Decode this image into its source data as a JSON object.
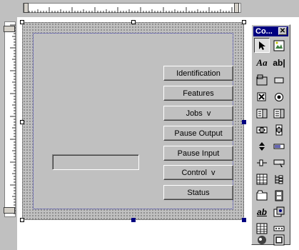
{
  "form": {
    "buttons": [
      {
        "label": "Identification"
      },
      {
        "label": "Features"
      },
      {
        "label": "Jobs  v"
      },
      {
        "label": "Pause Output"
      },
      {
        "label": "Pause Input"
      },
      {
        "label": "Control  v"
      },
      {
        "label": "Status"
      }
    ],
    "textbox_value": ""
  },
  "toolbox": {
    "title": "Co...",
    "close_glyph": "✕",
    "tools": [
      {
        "icon": "pointer-icon"
      },
      {
        "icon": "image-icon"
      },
      {
        "icon": "label-icon",
        "text": "Aa"
      },
      {
        "icon": "textbox-icon",
        "text": "ab|"
      },
      {
        "icon": "frame-icon"
      },
      {
        "icon": "command-button-icon"
      },
      {
        "icon": "checkbox-icon"
      },
      {
        "icon": "option-button-icon"
      },
      {
        "icon": "combobox-icon"
      },
      {
        "icon": "listbox-icon"
      },
      {
        "icon": "hscrollbar-icon"
      },
      {
        "icon": "vscrollbar-icon"
      },
      {
        "icon": "spinbutton-icon"
      },
      {
        "icon": "progressbar-icon"
      },
      {
        "icon": "slider-icon"
      },
      {
        "icon": "toolbar-icon"
      },
      {
        "icon": "grid-icon"
      },
      {
        "icon": "treeview-icon"
      },
      {
        "icon": "tabstrip-icon"
      },
      {
        "icon": "filmstrip-icon"
      },
      {
        "icon": "richtext-icon",
        "text": "ab"
      },
      {
        "icon": "imagelist-icon"
      },
      {
        "icon": "table-icon"
      },
      {
        "icon": "dots-icon"
      },
      {
        "icon": "animation-icon"
      },
      {
        "icon": "picture-icon"
      }
    ]
  },
  "colors": {
    "form_background": "#c0c0c0",
    "titlebar": "#000080",
    "selection_handle": "#000080"
  }
}
